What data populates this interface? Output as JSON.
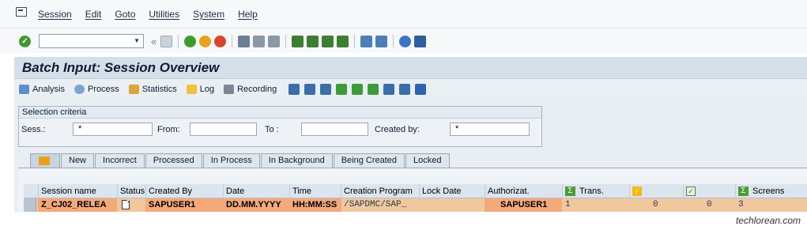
{
  "menu": [
    "Session",
    "Edit",
    "Goto",
    "Utilities",
    "System",
    "Help"
  ],
  "toolbar": {
    "command_field_value": "",
    "icons": [
      "enter-icon",
      "back-icon",
      "save-icon",
      "nav-back-icon",
      "exit-icon",
      "cancel-icon",
      "print-icon",
      "find-icon",
      "find-next-icon",
      "first-page-icon",
      "prev-page-icon",
      "next-page-icon",
      "last-page-icon",
      "new-session-icon",
      "shortcut-icon",
      "help-icon",
      "customize-icon"
    ]
  },
  "title": "Batch Input: Session Overview",
  "app_toolbar": {
    "analysis": "Analysis",
    "process": "Process",
    "statistics": "Statistics",
    "log": "Log",
    "recording": "Recording"
  },
  "selection": {
    "caption": "Selection criteria",
    "sess_label": "Sess.:",
    "sess_value": "*",
    "from_label": "From:",
    "from_value": "",
    "to_label": "To :",
    "to_value": "",
    "created_by_label": "Created by:",
    "created_by_value": "*"
  },
  "tabs": [
    "New",
    "Incorrect",
    "Processed",
    "In Process",
    "In Background",
    "Being Created",
    "Locked"
  ],
  "table": {
    "headers": {
      "session_name": "Session name",
      "status": "Status",
      "created_by": "Created By",
      "date": "Date",
      "time": "Time",
      "creation_program": "Creation Program",
      "lock_date": "Lock Date",
      "authorizat": "Authorizat.",
      "trans": "Trans.",
      "screens": "Screens"
    },
    "row": {
      "session_name": "Z_CJ02_RELEA",
      "created_by": "SAPUSER1",
      "date": "DD.MM.YYYY",
      "time": "HH:MM:SS",
      "creation_program": "/SAPDMC/SAP_",
      "lock_date": "",
      "authorizat": "SAPUSER1",
      "trans": "1",
      "error_count": "0",
      "processed_count": "0",
      "screens": "3"
    }
  },
  "watermark": "techlorean.com",
  "colors": {
    "row_highlight": "#f1c79e",
    "key_cell": "#f4a97a",
    "title_bg": "#d5dfe9"
  }
}
